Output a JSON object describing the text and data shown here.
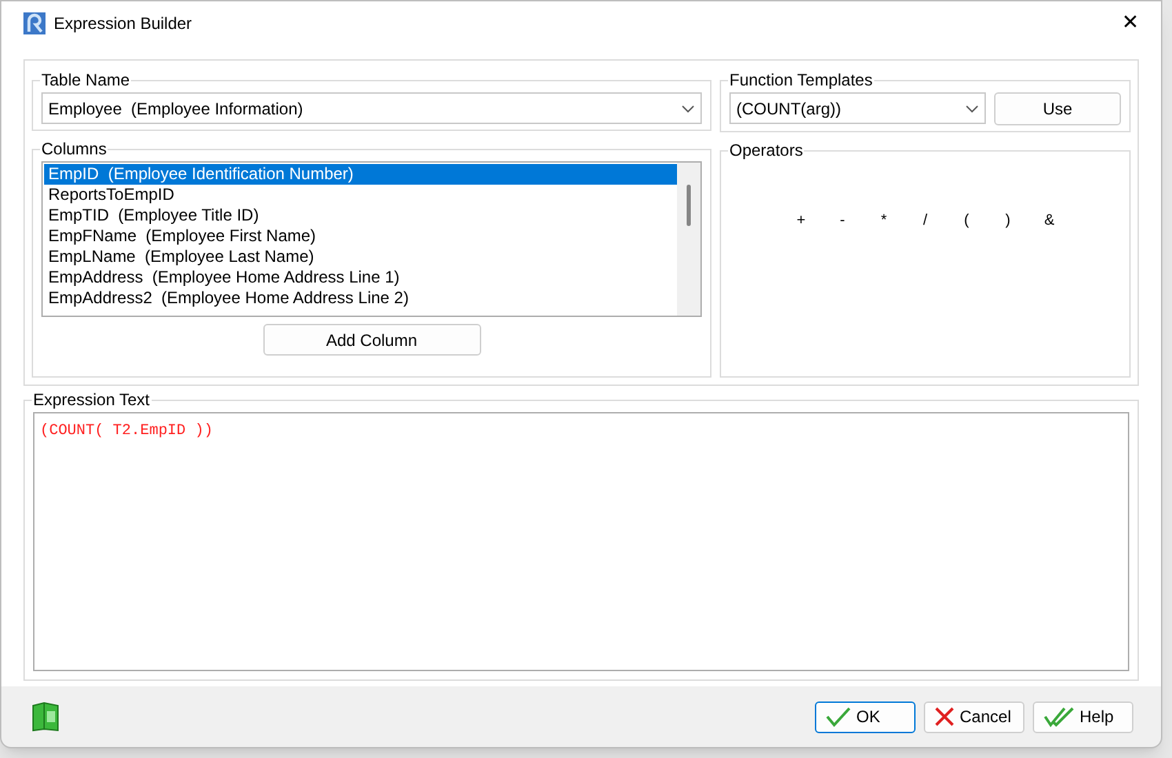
{
  "window": {
    "title": "Expression Builder",
    "close": "✕"
  },
  "table_name": {
    "label": "Table Name",
    "value": "Employee  (Employee Information)"
  },
  "columns": {
    "label": "Columns",
    "items": [
      {
        "text": "EmpID  (Employee Identification Number)",
        "selected": true
      },
      {
        "text": "ReportsToEmpID",
        "selected": false
      },
      {
        "text": "EmpTID  (Employee Title ID)",
        "selected": false
      },
      {
        "text": "EmpFName  (Employee First Name)",
        "selected": false
      },
      {
        "text": "EmpLName  (Employee Last Name)",
        "selected": false
      },
      {
        "text": "EmpAddress  (Employee Home Address Line 1)",
        "selected": false
      },
      {
        "text": "EmpAddress2  (Employee Home Address Line 2)",
        "selected": false
      }
    ],
    "button": "Add Column"
  },
  "function_templates": {
    "label": "Function Templates",
    "value": "(COUNT(arg))",
    "button": "Use"
  },
  "operators": {
    "label": "Operators",
    "items": [
      "+",
      "-",
      "*",
      "/",
      "(",
      ")",
      "&"
    ]
  },
  "expression_text": {
    "label": "Expression Text",
    "value": "(COUNT( T2.EmpID ))"
  },
  "buttons": [
    {
      "kind": "ok",
      "label": "OK"
    },
    {
      "kind": "cancel",
      "label": "Cancel"
    },
    {
      "kind": "help",
      "label": "Help"
    }
  ]
}
